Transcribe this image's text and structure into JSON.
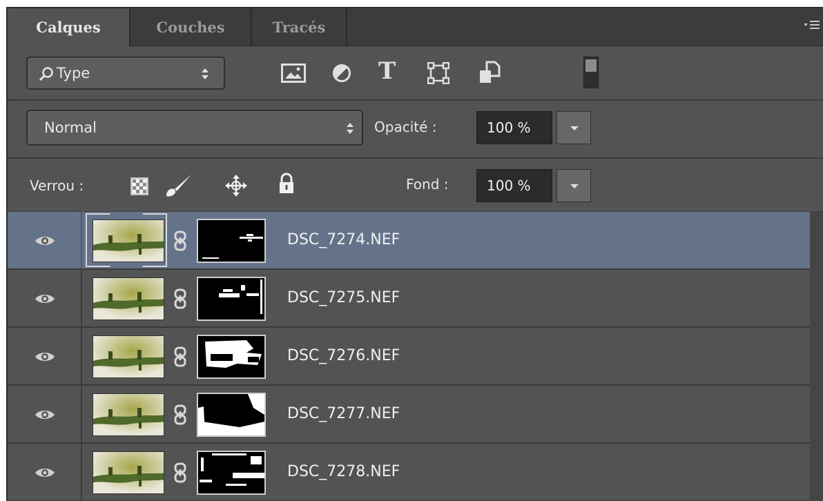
{
  "tabs": [
    {
      "label": "Calques",
      "active": true
    },
    {
      "label": "Couches",
      "active": false
    },
    {
      "label": "Tracés",
      "active": false
    }
  ],
  "panel_menu_icon": "panel-menu-icon",
  "filter": {
    "kind_label": "Type",
    "icons": [
      "pixel-layer-filter-icon",
      "adjustment-layer-filter-icon",
      "type-layer-filter-icon",
      "shape-layer-filter-icon",
      "smart-object-filter-icon"
    ],
    "type_glyph": "T"
  },
  "blend": {
    "mode": "Normal",
    "opacity_label": "Opacité :",
    "opacity_value": "100 %"
  },
  "lock": {
    "label": "Verrou :",
    "icons": [
      "lock-transparent-pixels-icon",
      "lock-image-pixels-icon",
      "lock-position-icon",
      "lock-all-icon"
    ],
    "fill_label": "Fond :",
    "fill_value": "100 %"
  },
  "layers": [
    {
      "name": "DSC_7274.NEF",
      "visible": true,
      "selected": true
    },
    {
      "name": "DSC_7275.NEF",
      "visible": true,
      "selected": false
    },
    {
      "name": "DSC_7276.NEF",
      "visible": true,
      "selected": false
    },
    {
      "name": "DSC_7277.NEF",
      "visible": true,
      "selected": false
    },
    {
      "name": "DSC_7278.NEF",
      "visible": true,
      "selected": false
    }
  ],
  "colors": {
    "panel_bg": "#535353",
    "tabbar_bg": "#3c3c3c",
    "selected_row": "#64738a",
    "field_bg": "#2b2b2b"
  }
}
